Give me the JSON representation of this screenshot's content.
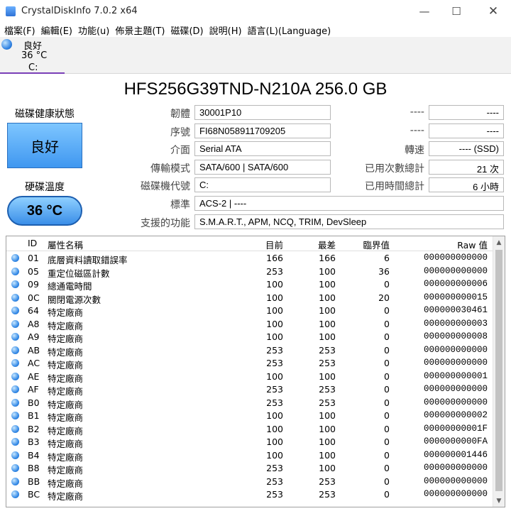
{
  "window": {
    "title": "CrystalDiskInfo 7.0.2 x64",
    "minimize_glyph": "—",
    "maximize_glyph": "☐",
    "close_glyph": "✕"
  },
  "menu": [
    "檔案(F)",
    "編輯(E)",
    "功能(u)",
    "佈景主題(T)",
    "磁碟(D)",
    "說明(H)",
    "語言(L)(Language)"
  ],
  "disk_tab": {
    "status": "良好",
    "temperature": "36 °C",
    "drive": "C:"
  },
  "model_title": "HFS256G39TND-N210A 256.0 GB",
  "health": {
    "label": "磁碟健康狀態",
    "value": "良好"
  },
  "temperature": {
    "label": "硬碟溫度",
    "value": "36 °C"
  },
  "info": {
    "firmware": {
      "label": "韌體",
      "value": "30001P10"
    },
    "serial": {
      "label": "序號",
      "value": "FI68N058911709205"
    },
    "interface": {
      "label": "介面",
      "value": "Serial ATA"
    },
    "transfer_mode": {
      "label": "傳輸模式",
      "value": "SATA/600 | SATA/600"
    },
    "drive_letter": {
      "label": "磁碟機代號",
      "value": "C:"
    },
    "standard": {
      "label": "標準",
      "value": "ACS-2 | ----"
    },
    "features": {
      "label": "支援的功能",
      "value": "S.M.A.R.T., APM, NCQ, TRIM, DevSleep"
    }
  },
  "info_right": {
    "unknown1": {
      "label": "----",
      "value": "----"
    },
    "unknown2": {
      "label": "----",
      "value": "----"
    },
    "rotation": {
      "label": "轉速",
      "value": "---- (SSD)"
    },
    "power_on_count": {
      "label": "已用次數總計",
      "value": "21 次"
    },
    "power_on_hours": {
      "label": "已用時間總計",
      "value": "6 小時"
    }
  },
  "smart": {
    "headers": {
      "id": "ID",
      "name": "屬性名稱",
      "current": "目前",
      "worst": "最差",
      "threshold": "臨界值",
      "raw": "Raw 值"
    },
    "rows": [
      {
        "id": "01",
        "name": "底層資料讀取錯誤率",
        "current": "166",
        "worst": "166",
        "threshold": "6",
        "raw": "000000000000"
      },
      {
        "id": "05",
        "name": "重定位磁區計數",
        "current": "253",
        "worst": "100",
        "threshold": "36",
        "raw": "000000000000"
      },
      {
        "id": "09",
        "name": "總通電時間",
        "current": "100",
        "worst": "100",
        "threshold": "0",
        "raw": "000000000006"
      },
      {
        "id": "0C",
        "name": "關閉電源次數",
        "current": "100",
        "worst": "100",
        "threshold": "20",
        "raw": "000000000015"
      },
      {
        "id": "64",
        "name": "特定廠商",
        "current": "100",
        "worst": "100",
        "threshold": "0",
        "raw": "000000030461"
      },
      {
        "id": "A8",
        "name": "特定廠商",
        "current": "100",
        "worst": "100",
        "threshold": "0",
        "raw": "000000000003"
      },
      {
        "id": "A9",
        "name": "特定廠商",
        "current": "100",
        "worst": "100",
        "threshold": "0",
        "raw": "000000000008"
      },
      {
        "id": "AB",
        "name": "特定廠商",
        "current": "253",
        "worst": "253",
        "threshold": "0",
        "raw": "000000000000"
      },
      {
        "id": "AC",
        "name": "特定廠商",
        "current": "253",
        "worst": "253",
        "threshold": "0",
        "raw": "000000000000"
      },
      {
        "id": "AE",
        "name": "特定廠商",
        "current": "100",
        "worst": "100",
        "threshold": "0",
        "raw": "000000000001"
      },
      {
        "id": "AF",
        "name": "特定廠商",
        "current": "253",
        "worst": "253",
        "threshold": "0",
        "raw": "000000000000"
      },
      {
        "id": "B0",
        "name": "特定廠商",
        "current": "253",
        "worst": "253",
        "threshold": "0",
        "raw": "000000000000"
      },
      {
        "id": "B1",
        "name": "特定廠商",
        "current": "100",
        "worst": "100",
        "threshold": "0",
        "raw": "000000000002"
      },
      {
        "id": "B2",
        "name": "特定廠商",
        "current": "100",
        "worst": "100",
        "threshold": "0",
        "raw": "00000000001F"
      },
      {
        "id": "B3",
        "name": "特定廠商",
        "current": "100",
        "worst": "100",
        "threshold": "0",
        "raw": "0000000000FA"
      },
      {
        "id": "B4",
        "name": "特定廠商",
        "current": "100",
        "worst": "100",
        "threshold": "0",
        "raw": "000000001446"
      },
      {
        "id": "B8",
        "name": "特定廠商",
        "current": "253",
        "worst": "100",
        "threshold": "0",
        "raw": "000000000000"
      },
      {
        "id": "BB",
        "name": "特定廠商",
        "current": "253",
        "worst": "253",
        "threshold": "0",
        "raw": "000000000000"
      },
      {
        "id": "BC",
        "name": "特定廠商",
        "current": "253",
        "worst": "253",
        "threshold": "0",
        "raw": "000000000000"
      }
    ]
  },
  "scrollbar": {
    "up_glyph": "▲",
    "down_glyph": "▼"
  }
}
